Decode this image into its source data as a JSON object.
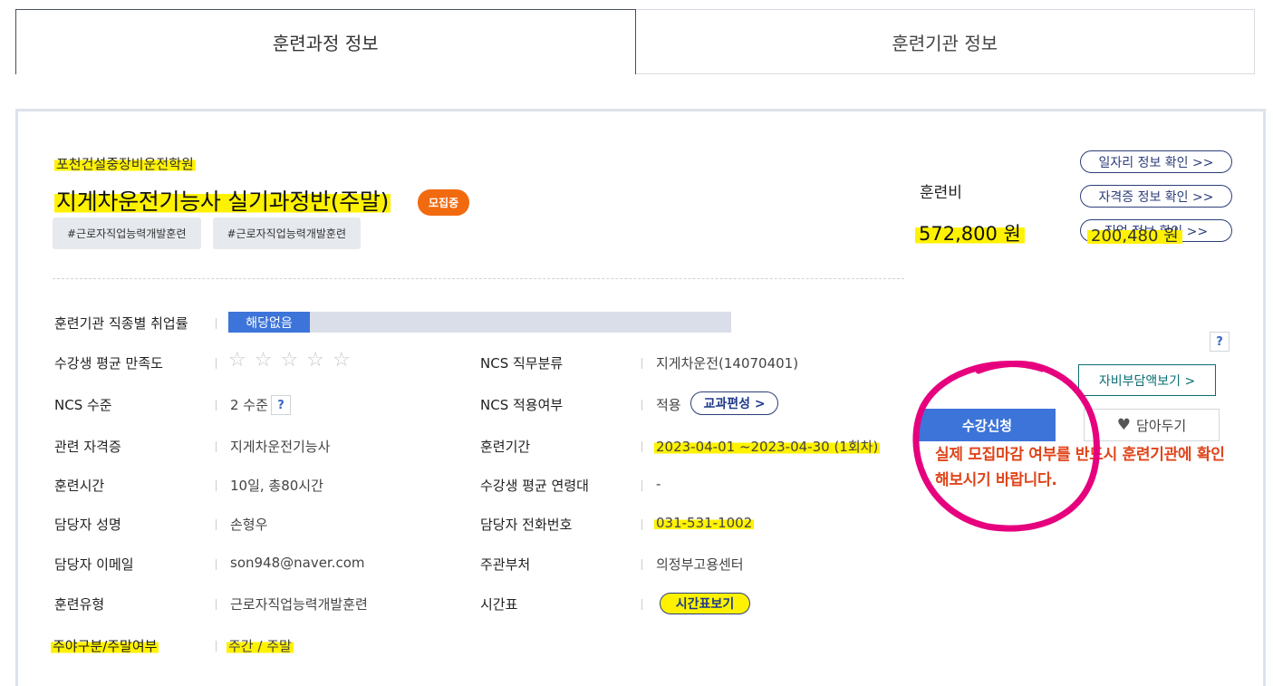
{
  "tabs": [
    {
      "label": "훈련과정 정보"
    },
    {
      "label": "훈련기관 정보"
    }
  ],
  "course": {
    "institution": "포천건설중장비운전학원",
    "title": "지게차운전기능사 실기과정반(주말)",
    "status_badge": "모집중",
    "tags": [
      "#근로자직업능력개발훈련",
      "#근로자직업능력개발훈련"
    ]
  },
  "side_links": [
    {
      "label": "일자리 정보 확인 >>"
    },
    {
      "label": "자격증 정보 확인 >>"
    },
    {
      "label": "직업 정보 확인 >>"
    }
  ],
  "info": {
    "employment_rate": {
      "label": "훈련기관 직종별 취업률",
      "value": "해당없음"
    },
    "satisfaction": {
      "label": "수강생 평균 만족도",
      "stars_filled": 0,
      "stars_total": 5
    },
    "ncs_category": {
      "label": "NCS 직무분류",
      "value": "지게차운전(14070401)"
    },
    "ncs_level": {
      "label": "NCS 수준",
      "value": "2 수준",
      "help": "?"
    },
    "ncs_applied": {
      "label": "NCS 적용여부",
      "value": "적용",
      "button": "교과편성 >"
    },
    "certificate": {
      "label": "관련 자격증",
      "value": "지게차운전기능사"
    },
    "period": {
      "label": "훈련기간",
      "value": "2023-04-01 ~2023-04-30 (1회차)"
    },
    "hours": {
      "label": "훈련시간",
      "value": "10일, 총80시간"
    },
    "age": {
      "label": "수강생 평균 연령대",
      "value": "-"
    },
    "manager_name": {
      "label": "담당자 성명",
      "value": "손형우"
    },
    "manager_phone": {
      "label": "담당자 전화번호",
      "value": "031-531-1002"
    },
    "manager_email": {
      "label": "담당자 이메일",
      "value": "son948@naver.com"
    },
    "department": {
      "label": "주관부처",
      "value": "의정부고용센터"
    },
    "training_type": {
      "label": "훈련유형",
      "value": "근로자직업능력개발훈련"
    },
    "timetable": {
      "label": "시간표",
      "button": "시간표보기"
    },
    "day_type": {
      "label": "주야구분/주말여부",
      "value": "주간 / 주말"
    }
  },
  "fee": {
    "label": "훈련비",
    "total": "572,800 원",
    "self_pay": "200,480 원",
    "help": "?",
    "self_pay_button": "자비부담액보기 >"
  },
  "actions": {
    "apply": "수강신청",
    "wishlist": "담아두기"
  },
  "notice": "실제 모집마감 여부를 반드시 훈련기관에 확인해보시기 바랍니다.",
  "colors": {
    "accent_blue": "#3d74d9",
    "badge_orange": "#f26a10",
    "notice_orange": "#e0441a",
    "highlight_yellow": "#fff200",
    "annotation_magenta": "#e6007e"
  }
}
